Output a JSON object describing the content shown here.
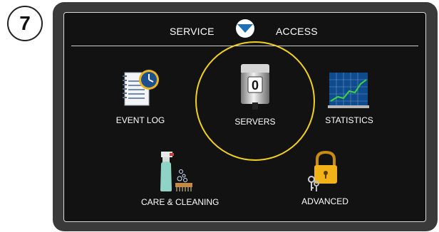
{
  "step": {
    "number": "7"
  },
  "header": {
    "left_label": "SERVICE",
    "right_label": "ACCESS",
    "logo_icon": "brand-logo-icon"
  },
  "menu": {
    "items": [
      {
        "label": "EVENT LOG",
        "icon": "event-log-icon"
      },
      {
        "label": "SERVERS",
        "icon": "server-icon",
        "value": "0"
      },
      {
        "label": "STATISTICS",
        "icon": "statistics-chart-icon"
      },
      {
        "label": "CARE & CLEANING",
        "icon": "cleaning-spray-icon"
      },
      {
        "label": "ADVANCED",
        "icon": "padlock-keys-icon"
      }
    ],
    "highlighted": "SERVERS"
  },
  "colors": {
    "highlight": "#f2d21b",
    "screen": "#121212",
    "bezel": "#3a3a3a",
    "logo_blue": "#1f6fb5"
  }
}
